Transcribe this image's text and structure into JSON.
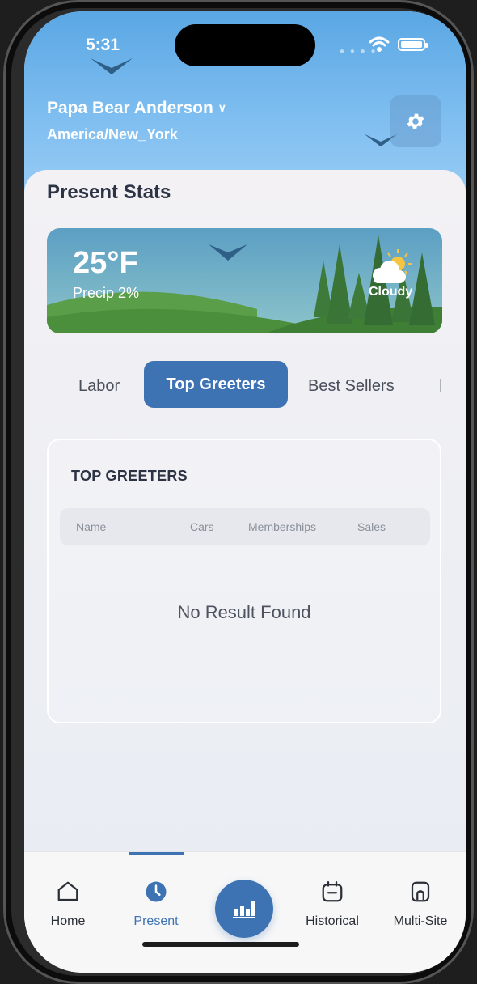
{
  "status_bar": {
    "time": "5:31"
  },
  "header": {
    "site_name": "Papa Bear Anderson",
    "timezone": "America/New_York"
  },
  "page": {
    "title": "Present Stats"
  },
  "weather": {
    "temperature": "25°F",
    "precip": "Precip 2%",
    "condition": "Cloudy",
    "condition_icon": "partly-cloudy-icon"
  },
  "tabs": [
    {
      "label": "Labor",
      "active": false
    },
    {
      "label": "Top Greeters",
      "active": true
    },
    {
      "label": "Best Sellers",
      "active": false
    }
  ],
  "card": {
    "title": "TOP GREETERS",
    "columns": [
      "Name",
      "Cars",
      "Memberships",
      "Sales"
    ],
    "rows": [],
    "empty_message": "No Result Found"
  },
  "nav": {
    "items": [
      {
        "label": "Home",
        "icon": "home-icon"
      },
      {
        "label": "Present",
        "icon": "clock-icon",
        "active": true
      },
      {
        "label": "",
        "icon": "bar-chart-icon"
      },
      {
        "label": "Historical",
        "icon": "calendar-icon"
      },
      {
        "label": "Multi-Site",
        "icon": "site-icon"
      }
    ]
  },
  "colors": {
    "accent": "#3e73b3",
    "header_sky": "#6cb2ea",
    "text_dark": "#2c3344"
  }
}
